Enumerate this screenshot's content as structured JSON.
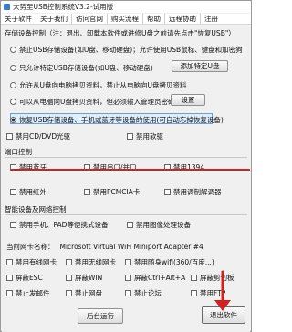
{
  "window": {
    "title": "大势至USB控制系统V3.2-试用版"
  },
  "menu": [
    "关于软件",
    "关于我们",
    "访问官网",
    "购买流程",
    "帮助",
    "远程协助",
    "注册"
  ],
  "storage": {
    "header": "存储设备控制（注：退出、卸载本软件或进修U盘之前请先点击\"恢复USB\"）",
    "options": [
      "禁止USB存储设备(如U盘、移动硬盘)；允许使用USB鼠标、键盘和加密狗",
      "只允许特定USB存储设备(如U盘、移动硬盘)",
      "允许从U盘向电脑拷贝资料，禁止从电脑向U盘拷贝资料",
      "可以从电脑向U盘拷贝资料，但必须输入管理员密码",
      "恢复USB存储设备、手机或蓝牙等设备的使用(可自动忘掉恢复设备)"
    ],
    "selected_index": 4,
    "add_special_button": "添加特定U盘",
    "settings_button": "设置"
  },
  "device_checks": {
    "cd": "禁用CD/DVD光驱",
    "floppy": "禁用软驱"
  },
  "port": {
    "header": "端口控制",
    "items": [
      "禁用蓝牙",
      "禁用串口/并口",
      "禁用1394",
      "禁用红外",
      "禁用PCMCIA卡",
      "禁用调制解调器"
    ]
  },
  "smart": {
    "header": "智能设备及网络控制",
    "items": [
      "禁用手机、PAD等便携式设备",
      "禁用图像处理设备"
    ]
  },
  "nic": {
    "label": "当前网卡名称：",
    "value": "Microsoft Virtual WiFi Miniport Adapter #4"
  },
  "misc": {
    "items": [
      "禁用有线网卡",
      "禁用无线网卡",
      "禁用随身wifi(360/百度...)",
      "屏蔽ESC",
      "屏蔽WIN",
      "屏蔽Ctrl+Alt+A",
      "屏蔽剪切板",
      "禁止发邮件",
      "禁止网盘",
      "禁止论坛",
      "禁用FTP"
    ]
  },
  "buttons": {
    "background_run": "后台运行",
    "exit": "退出软件"
  },
  "colors": {
    "selection_highlight": "#dfeefc",
    "annotation_red": "#d42020"
  }
}
